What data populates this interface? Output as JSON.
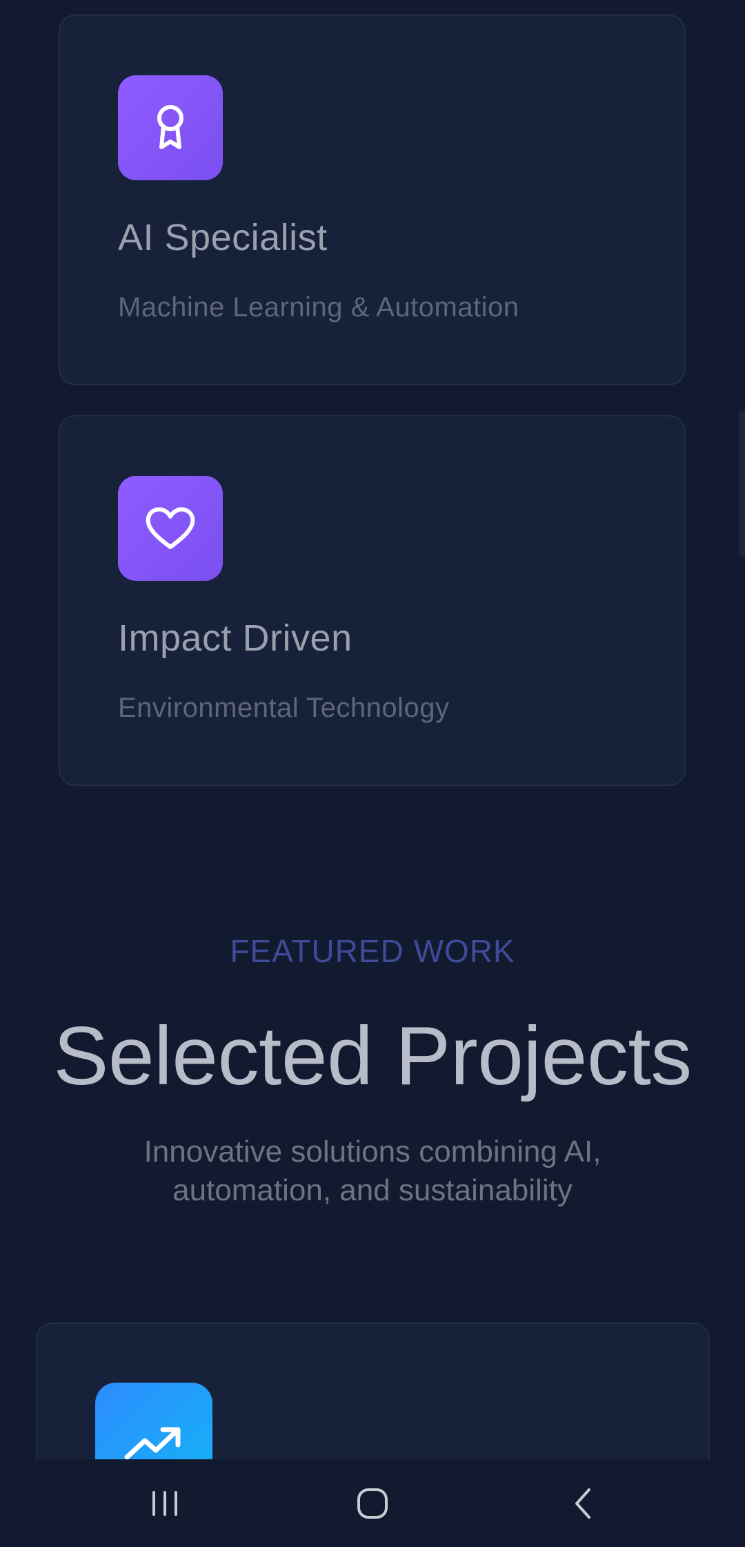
{
  "cards": [
    {
      "icon": "award-icon",
      "title": "AI Specialist",
      "subtitle": "Machine Learning & Automation"
    },
    {
      "icon": "heart-icon",
      "title": "Impact Driven",
      "subtitle": "Environmental Technology"
    }
  ],
  "featured": {
    "eyebrow": "FEATURED WORK",
    "title": "Selected Projects",
    "description": "Innovative solutions combining AI, automation, and sustainability"
  },
  "projects": [
    {
      "icon": "trending-up-icon"
    }
  ],
  "colors": {
    "background": "#111a2e",
    "card": "#17213a",
    "accent_purple": "#8b5cf6",
    "accent_blue": "#1ea4ff",
    "eyebrow": "#3f4b99"
  },
  "system_nav": {
    "recents": "recents-icon",
    "home": "home-icon",
    "back": "back-icon"
  }
}
